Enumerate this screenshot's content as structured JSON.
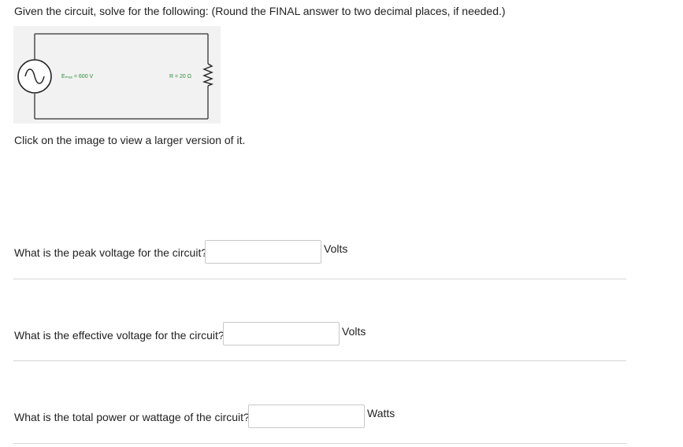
{
  "header": {
    "instructions": "Given the circuit, solve for the following: (Round the FINAL answer to two decimal places, if needed.)"
  },
  "circuit": {
    "source_label": "Eₘₐₓ = 600 V",
    "resistor_label": "R = 20 Ω",
    "source_icon": "ac-source-icon",
    "resistor_icon": "resistor-icon",
    "label_color": "#2e8b3e"
  },
  "note": {
    "text": "Click on the image to view a larger version of it."
  },
  "questions": [
    {
      "label": "What is the peak voltage for the circuit?",
      "value": "",
      "unit": "Volts"
    },
    {
      "label": "What is the effective voltage for the circuit?",
      "value": "",
      "unit": "Volts"
    },
    {
      "label": "What is the total power or wattage of the circuit?",
      "value": "",
      "unit": "Watts"
    }
  ]
}
